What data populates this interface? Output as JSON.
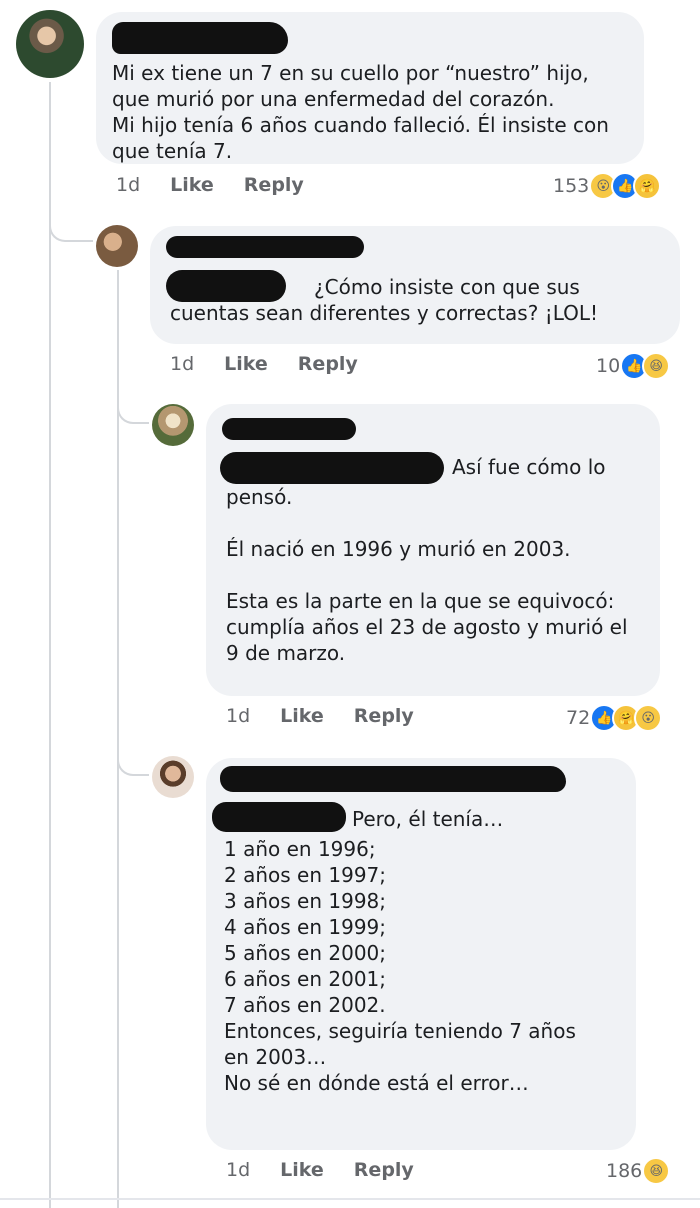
{
  "comments": [
    {
      "text": "Mi ex tiene un 7 en su cuello por “nuestro” hijo,\nque murió por una enfermedad del corazón.\nMi hijo tenía 6 años cuando falleció. Él insiste con\nque tenía 7.",
      "time": "1d",
      "like": "Like",
      "reply": "Reply",
      "reaction_count": "153",
      "reactions": [
        "wow-icon",
        "like-icon",
        "care-icon"
      ]
    },
    {
      "text": "¿Cómo insiste con que sus\ncuentas sean diferentes y correctas? ¡LOL!",
      "time": "1d",
      "like": "Like",
      "reply": "Reply",
      "reaction_count": "10",
      "reactions": [
        "like-icon",
        "haha-icon"
      ]
    },
    {
      "text_first": "Así fue cómo lo",
      "text": "pensó.\n\nÉl nació en 1996 y murió en 2003.\n\nEsta es la parte en la que se equivocó:\ncumplía años el 23 de agosto y murió el\n9 de marzo.",
      "time": "1d",
      "like": "Like",
      "reply": "Reply",
      "reaction_count": "72",
      "reactions": [
        "like-icon",
        "care-icon",
        "wow-icon"
      ]
    },
    {
      "text_first": "Pero, él tenía…",
      "text": "1 año en 1996;\n2 años en 1997;\n3 años en 1998;\n4 años en 1999;\n5 años en 2000;\n6 años en 2001;\n7 años en 2002.\nEntonces, seguiría teniendo 7 años\nen 2003…\nNo sé en dónde está el error…",
      "time": "1d",
      "like": "Like",
      "reply": "Reply",
      "reaction_count": "186",
      "reactions": [
        "haha-icon"
      ]
    }
  ],
  "colors": {
    "bubble": "#f0f2f5",
    "like": "#1877f2",
    "emoji": "#f7c844",
    "meta": "#65676b"
  }
}
